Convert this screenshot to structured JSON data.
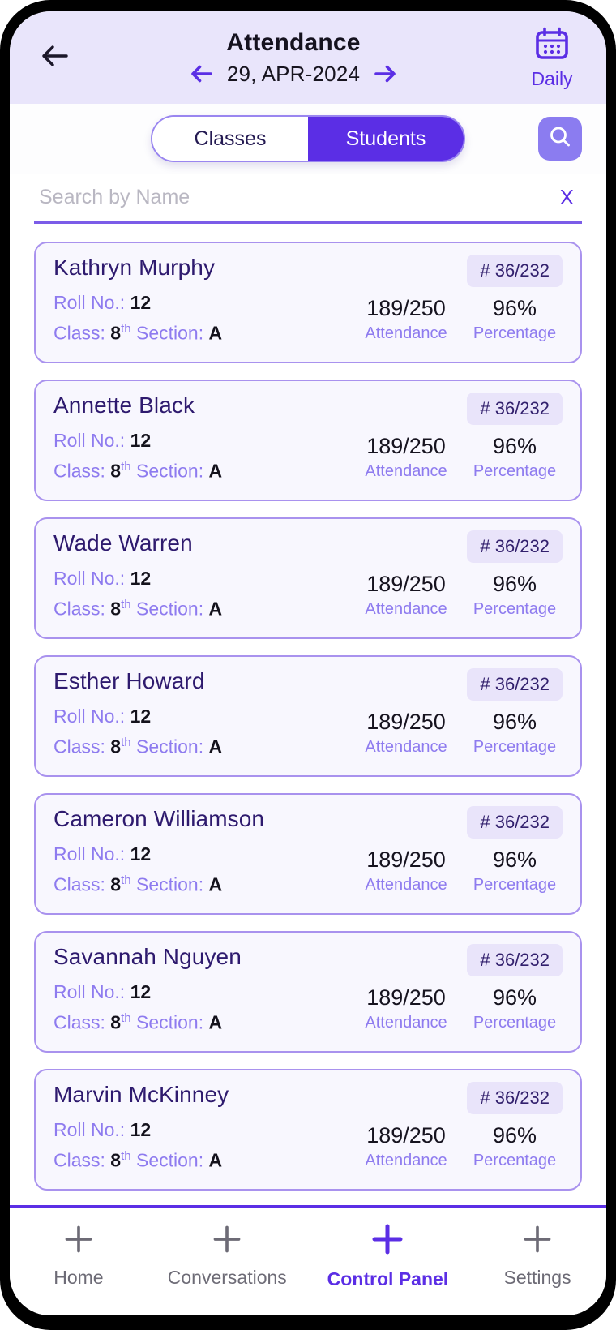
{
  "header": {
    "back_icon": "arrow-left-icon",
    "title": "Attendance",
    "prev_icon": "arrow-left-icon",
    "date": "29, APR-2024",
    "next_icon": "arrow-right-icon",
    "calendar_icon": "calendar-icon",
    "daily_label": "Daily",
    "bg_color": "#e9e5fb",
    "accent_color": "#5b2ee5"
  },
  "tabs": {
    "classes_label": "Classes",
    "students_label": "Students",
    "active": "Students",
    "search_icon": "search-icon"
  },
  "search": {
    "value": "",
    "placeholder": "Search by Name",
    "clear_label": "X"
  },
  "card_labels": {
    "roll": "Roll No.:",
    "class": "Class:",
    "section": "Section:",
    "attendance_caption": "Attendance",
    "percentage_caption": "Percentage"
  },
  "students": [
    {
      "name": "Kathryn Murphy",
      "rank": "# 36/232",
      "roll": "12",
      "class": "8",
      "class_suffix": "th",
      "section": "A",
      "attendance": "189/250",
      "percentage": "96%"
    },
    {
      "name": "Annette Black",
      "rank": "# 36/232",
      "roll": "12",
      "class": "8",
      "class_suffix": "th",
      "section": "A",
      "attendance": "189/250",
      "percentage": "96%"
    },
    {
      "name": "Wade Warren",
      "rank": "# 36/232",
      "roll": "12",
      "class": "8",
      "class_suffix": "th",
      "section": "A",
      "attendance": "189/250",
      "percentage": "96%"
    },
    {
      "name": "Esther Howard",
      "rank": "# 36/232",
      "roll": "12",
      "class": "8",
      "class_suffix": "th",
      "section": "A",
      "attendance": "189/250",
      "percentage": "96%"
    },
    {
      "name": "Cameron Williamson",
      "rank": "# 36/232",
      "roll": "12",
      "class": "8",
      "class_suffix": "th",
      "section": "A",
      "attendance": "189/250",
      "percentage": "96%"
    },
    {
      "name": "Savannah Nguyen",
      "rank": "# 36/232",
      "roll": "12",
      "class": "8",
      "class_suffix": "th",
      "section": "A",
      "attendance": "189/250",
      "percentage": "96%"
    },
    {
      "name": "Marvin McKinney",
      "rank": "# 36/232",
      "roll": "12",
      "class": "8",
      "class_suffix": "th",
      "section": "A",
      "attendance": "189/250",
      "percentage": "96%"
    }
  ],
  "bottom_nav": {
    "active": "Control Panel",
    "items": [
      {
        "label": "Home",
        "icon": "plus-icon"
      },
      {
        "label": "Conversations",
        "icon": "plus-icon"
      },
      {
        "label": "Control Panel",
        "icon": "plus-icon"
      },
      {
        "label": "Settings",
        "icon": "plus-icon"
      }
    ]
  }
}
